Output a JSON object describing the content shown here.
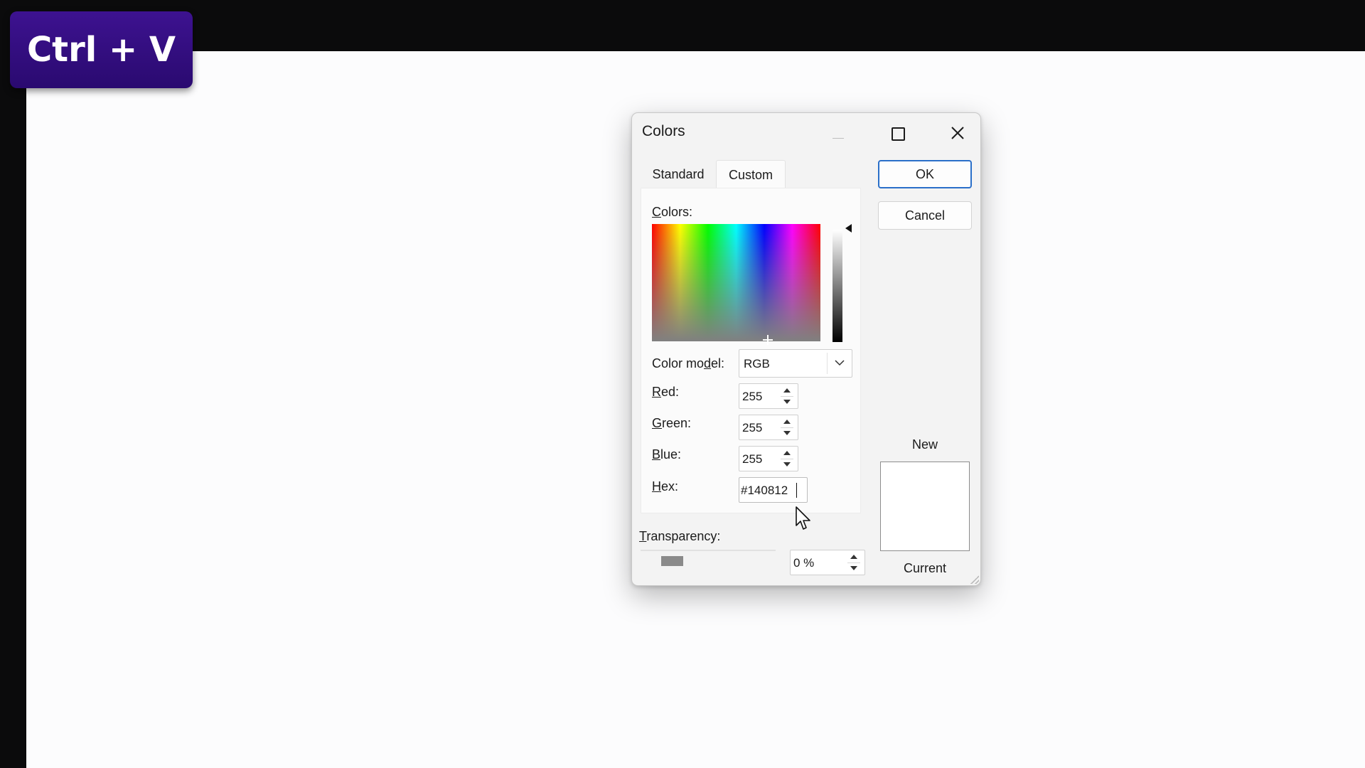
{
  "overlay": {
    "shortcut": "Ctrl + V"
  },
  "dialog": {
    "title": "Colors",
    "tabs": [
      "Standard",
      "Custom"
    ],
    "active_tab": "Custom",
    "colors_label_prefix": "",
    "colors_label_hotkey": "C",
    "colors_label_rest": "olors:",
    "color_model": {
      "label_pre": "Color mo",
      "label_hotkey": "d",
      "label_post": "el:",
      "value": "RGB"
    },
    "fields": {
      "red": {
        "hotkey": "R",
        "rest": "ed:",
        "value": "255"
      },
      "green": {
        "hotkey": "G",
        "rest": "reen:",
        "value": "255"
      },
      "blue": {
        "hotkey": "B",
        "rest": "lue:",
        "value": "255"
      },
      "hex": {
        "hotkey": "H",
        "rest": "ex:",
        "value": "#140812"
      }
    },
    "transparency": {
      "hotkey": "T",
      "rest": "ransparency:",
      "value": "0 %",
      "level": 0
    },
    "buttons": {
      "ok": "OK",
      "cancel": "Cancel"
    },
    "preview": {
      "new_label": "New",
      "current_label": "Current",
      "new_color": "#ffffff",
      "current_color": "#ffffff"
    }
  },
  "colors": {
    "accent": "#2a6fc9",
    "badge": "#2f0b7a"
  }
}
